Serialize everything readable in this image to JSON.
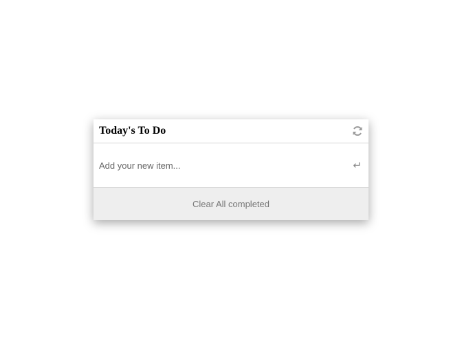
{
  "header": {
    "title": "Today's To Do",
    "refresh_icon": "refresh-icon"
  },
  "new_item": {
    "placeholder": "Add your new item...",
    "value": "",
    "submit_icon": "enter-icon"
  },
  "footer": {
    "clear_label": "Clear All completed"
  }
}
